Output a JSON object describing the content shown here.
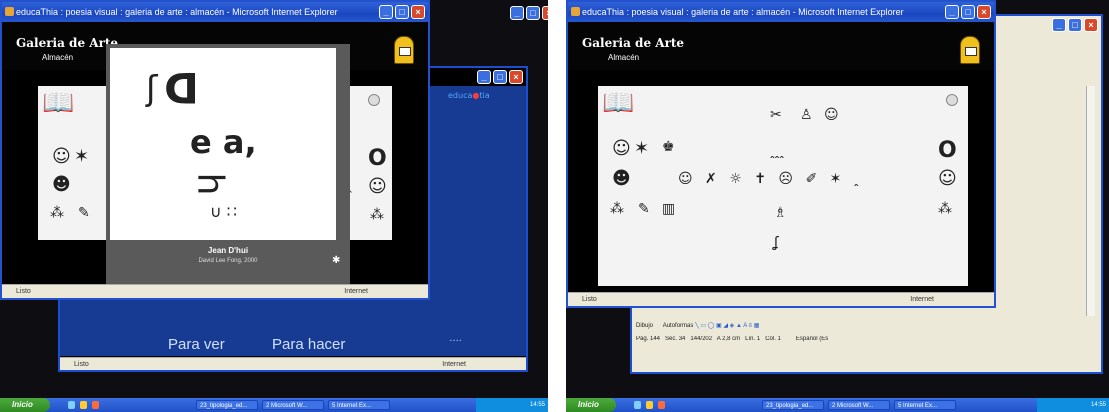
{
  "screenshots": [
    {
      "ie_title": "educaThia : poesia visual : galeria de arte : almacén - Microsoft Internet Explorer",
      "gallery_title": "Galeria de Arte",
      "gallery_subtitle": "Almacén",
      "modal": {
        "artwork_title": "Jean D'hui",
        "artwork_credit": "David Lee Fong, 2000"
      },
      "background_window": {
        "nav_left": "Para ver",
        "nav_right": "Para hacer",
        "status_left": "Listo",
        "status_right": "Internet"
      },
      "status_left": "Listo",
      "status_right": "Internet"
    },
    {
      "ie_title": "educaThia : poesia visual : galeria de arte : almacén - Microsoft Internet Explorer",
      "gallery_title": "Galeria de Arte",
      "gallery_subtitle": "Almacén",
      "status_left": "Listo",
      "status_right": "Internet",
      "word_status": {
        "page": "Pág. 144",
        "section": "Sec. 34",
        "pages": "144/202",
        "position": "A 2,8 cm",
        "line": "Lín. 1",
        "col": "Col. 1",
        "language": "Español (Es"
      },
      "word_draw_toolbar": {
        "draw": "Dibujo",
        "autoshapes": "Autoformas"
      }
    }
  ],
  "taskbar": {
    "start": "Inicio",
    "tasks": [
      "23_tipologia_ed...",
      "2 Microsoft W...",
      "5 Internet Ex..."
    ],
    "clock": "14:55"
  },
  "glyphs": {
    "bold_o": "O",
    "modal_letters": "e a,"
  },
  "colors": {
    "xp_blue": "#1c4fcf",
    "xp_green": "#2e8a22",
    "tray_blue": "#0f8ddf",
    "mailbox": "#f2c01d"
  }
}
